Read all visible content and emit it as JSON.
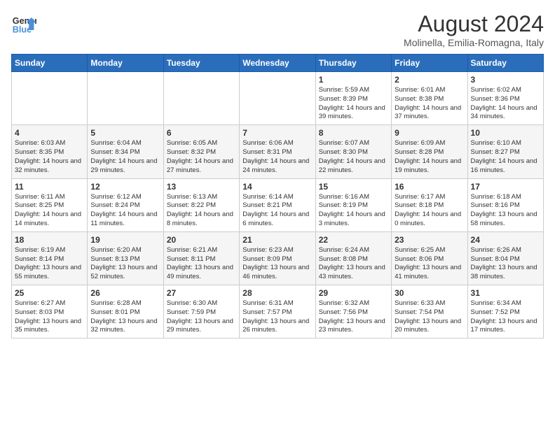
{
  "logo": {
    "text_general": "General",
    "text_blue": "Blue"
  },
  "title": "August 2024",
  "subtitle": "Molinella, Emilia-Romagna, Italy",
  "days_of_week": [
    "Sunday",
    "Monday",
    "Tuesday",
    "Wednesday",
    "Thursday",
    "Friday",
    "Saturday"
  ],
  "weeks": [
    [
      {
        "day": "",
        "info": ""
      },
      {
        "day": "",
        "info": ""
      },
      {
        "day": "",
        "info": ""
      },
      {
        "day": "",
        "info": ""
      },
      {
        "day": "1",
        "info": "Sunrise: 5:59 AM\nSunset: 8:39 PM\nDaylight: 14 hours and 39 minutes."
      },
      {
        "day": "2",
        "info": "Sunrise: 6:01 AM\nSunset: 8:38 PM\nDaylight: 14 hours and 37 minutes."
      },
      {
        "day": "3",
        "info": "Sunrise: 6:02 AM\nSunset: 8:36 PM\nDaylight: 14 hours and 34 minutes."
      }
    ],
    [
      {
        "day": "4",
        "info": "Sunrise: 6:03 AM\nSunset: 8:35 PM\nDaylight: 14 hours and 32 minutes."
      },
      {
        "day": "5",
        "info": "Sunrise: 6:04 AM\nSunset: 8:34 PM\nDaylight: 14 hours and 29 minutes."
      },
      {
        "day": "6",
        "info": "Sunrise: 6:05 AM\nSunset: 8:32 PM\nDaylight: 14 hours and 27 minutes."
      },
      {
        "day": "7",
        "info": "Sunrise: 6:06 AM\nSunset: 8:31 PM\nDaylight: 14 hours and 24 minutes."
      },
      {
        "day": "8",
        "info": "Sunrise: 6:07 AM\nSunset: 8:30 PM\nDaylight: 14 hours and 22 minutes."
      },
      {
        "day": "9",
        "info": "Sunrise: 6:09 AM\nSunset: 8:28 PM\nDaylight: 14 hours and 19 minutes."
      },
      {
        "day": "10",
        "info": "Sunrise: 6:10 AM\nSunset: 8:27 PM\nDaylight: 14 hours and 16 minutes."
      }
    ],
    [
      {
        "day": "11",
        "info": "Sunrise: 6:11 AM\nSunset: 8:25 PM\nDaylight: 14 hours and 14 minutes."
      },
      {
        "day": "12",
        "info": "Sunrise: 6:12 AM\nSunset: 8:24 PM\nDaylight: 14 hours and 11 minutes."
      },
      {
        "day": "13",
        "info": "Sunrise: 6:13 AM\nSunset: 8:22 PM\nDaylight: 14 hours and 8 minutes."
      },
      {
        "day": "14",
        "info": "Sunrise: 6:14 AM\nSunset: 8:21 PM\nDaylight: 14 hours and 6 minutes."
      },
      {
        "day": "15",
        "info": "Sunrise: 6:16 AM\nSunset: 8:19 PM\nDaylight: 14 hours and 3 minutes."
      },
      {
        "day": "16",
        "info": "Sunrise: 6:17 AM\nSunset: 8:18 PM\nDaylight: 14 hours and 0 minutes."
      },
      {
        "day": "17",
        "info": "Sunrise: 6:18 AM\nSunset: 8:16 PM\nDaylight: 13 hours and 58 minutes."
      }
    ],
    [
      {
        "day": "18",
        "info": "Sunrise: 6:19 AM\nSunset: 8:14 PM\nDaylight: 13 hours and 55 minutes."
      },
      {
        "day": "19",
        "info": "Sunrise: 6:20 AM\nSunset: 8:13 PM\nDaylight: 13 hours and 52 minutes."
      },
      {
        "day": "20",
        "info": "Sunrise: 6:21 AM\nSunset: 8:11 PM\nDaylight: 13 hours and 49 minutes."
      },
      {
        "day": "21",
        "info": "Sunrise: 6:23 AM\nSunset: 8:09 PM\nDaylight: 13 hours and 46 minutes."
      },
      {
        "day": "22",
        "info": "Sunrise: 6:24 AM\nSunset: 8:08 PM\nDaylight: 13 hours and 43 minutes."
      },
      {
        "day": "23",
        "info": "Sunrise: 6:25 AM\nSunset: 8:06 PM\nDaylight: 13 hours and 41 minutes."
      },
      {
        "day": "24",
        "info": "Sunrise: 6:26 AM\nSunset: 8:04 PM\nDaylight: 13 hours and 38 minutes."
      }
    ],
    [
      {
        "day": "25",
        "info": "Sunrise: 6:27 AM\nSunset: 8:03 PM\nDaylight: 13 hours and 35 minutes."
      },
      {
        "day": "26",
        "info": "Sunrise: 6:28 AM\nSunset: 8:01 PM\nDaylight: 13 hours and 32 minutes."
      },
      {
        "day": "27",
        "info": "Sunrise: 6:30 AM\nSunset: 7:59 PM\nDaylight: 13 hours and 29 minutes."
      },
      {
        "day": "28",
        "info": "Sunrise: 6:31 AM\nSunset: 7:57 PM\nDaylight: 13 hours and 26 minutes."
      },
      {
        "day": "29",
        "info": "Sunrise: 6:32 AM\nSunset: 7:56 PM\nDaylight: 13 hours and 23 minutes."
      },
      {
        "day": "30",
        "info": "Sunrise: 6:33 AM\nSunset: 7:54 PM\nDaylight: 13 hours and 20 minutes."
      },
      {
        "day": "31",
        "info": "Sunrise: 6:34 AM\nSunset: 7:52 PM\nDaylight: 13 hours and 17 minutes."
      }
    ]
  ]
}
